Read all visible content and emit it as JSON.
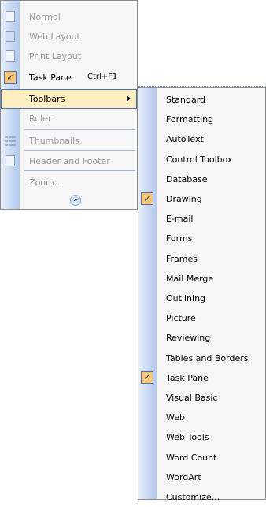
{
  "view_menu": {
    "items": [
      {
        "label": "Normal",
        "icon": "normal-view-icon",
        "disabled": true
      },
      {
        "label": "Web Layout",
        "icon": "web-layout-icon",
        "disabled": true
      },
      {
        "label": "Print Layout",
        "icon": "print-layout-icon",
        "disabled": true
      },
      {
        "label": "Task Pane",
        "shortcut": "Ctrl+F1",
        "checked": true
      },
      {
        "label": "Toolbars",
        "submenu": true,
        "highlighted": true
      },
      {
        "label": "Ruler",
        "disabled": true
      },
      {
        "label": "Thumbnails",
        "icon": "thumbnails-icon",
        "disabled": true
      },
      {
        "label": "Header and Footer",
        "icon": "header-footer-icon",
        "disabled": true
      },
      {
        "label": "Zoom...",
        "disabled": true
      }
    ],
    "expand_glyph": "»"
  },
  "toolbars_menu": {
    "items": [
      {
        "label": "Standard"
      },
      {
        "label": "Formatting"
      },
      {
        "label": "AutoText"
      },
      {
        "label": "Control Toolbox"
      },
      {
        "label": "Database"
      },
      {
        "label": "Drawing",
        "checked": true
      },
      {
        "label": "E-mail"
      },
      {
        "label": "Forms"
      },
      {
        "label": "Frames"
      },
      {
        "label": "Mail Merge"
      },
      {
        "label": "Outlining"
      },
      {
        "label": "Picture"
      },
      {
        "label": "Reviewing"
      },
      {
        "label": "Tables and Borders"
      },
      {
        "label": "Task Pane",
        "checked": true
      },
      {
        "label": "Visual Basic"
      },
      {
        "label": "Web"
      },
      {
        "label": "Web Tools"
      },
      {
        "label": "Word Count"
      },
      {
        "label": "WordArt"
      },
      {
        "label": "Customize..."
      }
    ]
  },
  "colors": {
    "highlight": "#ffeec2",
    "highlight_border": "#4b6fb5",
    "check_bg": "#ffc572",
    "gutter": "#c5d7f2"
  }
}
